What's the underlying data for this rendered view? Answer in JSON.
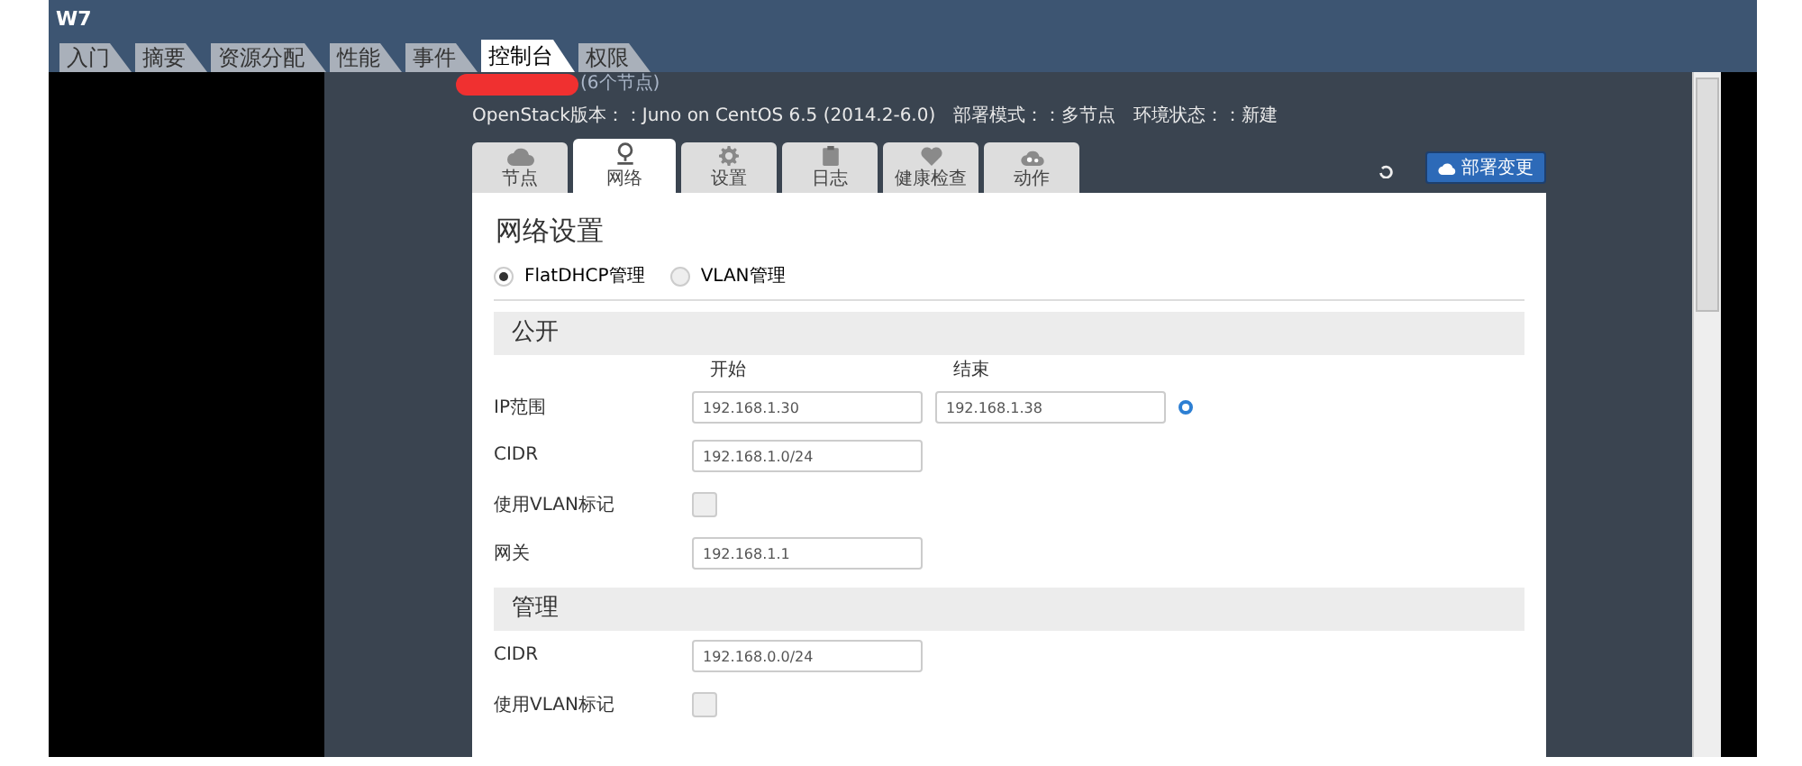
{
  "window": {
    "title": "W7"
  },
  "tabs": [
    {
      "label": "入门",
      "selected": false
    },
    {
      "label": "摘要",
      "selected": false
    },
    {
      "label": "资源分配",
      "selected": false
    },
    {
      "label": "性能",
      "selected": false
    },
    {
      "label": "事件",
      "selected": false
    },
    {
      "label": "控制台",
      "selected": true
    },
    {
      "label": "权限",
      "selected": false
    }
  ],
  "environment": {
    "node_count": "(6个节点)",
    "info": [
      "OpenStack版本：：Juno on CentOS 6.5 (2014.2-6.0)",
      "部署模式：：多节点",
      "环境状态：：新建"
    ]
  },
  "icon_tabs": [
    {
      "label": "节点",
      "kind": "cloud",
      "selected": false
    },
    {
      "label": "网络",
      "kind": "network",
      "selected": true
    },
    {
      "label": "设置",
      "kind": "gear",
      "selected": false
    },
    {
      "label": "日志",
      "kind": "clipboard",
      "selected": false
    },
    {
      "label": "健康检查",
      "kind": "heart",
      "selected": false
    },
    {
      "label": "动作",
      "kind": "cogs",
      "selected": false
    }
  ],
  "deploy_button": "部署变更",
  "form": {
    "title": "网络设置",
    "network_modes": [
      {
        "label": "FlatDHCP管理",
        "selected": true
      },
      {
        "label": "VLAN管理",
        "selected": false
      }
    ],
    "sections": [
      {
        "title": "公开",
        "fields": [
          {
            "kind": "range",
            "label": "IP范围",
            "start_label": "开始",
            "end_label": "结束",
            "start": "192.168.1.30",
            "end": "192.168.1.38"
          },
          {
            "kind": "text",
            "label": "CIDR",
            "value": "192.168.1.0/24"
          },
          {
            "kind": "checkbox",
            "label": "使用VLAN标记",
            "checked": false
          },
          {
            "kind": "text",
            "label": "网关",
            "value": "192.168.1.1"
          }
        ]
      },
      {
        "title": "管理",
        "fields": [
          {
            "kind": "text",
            "label": "CIDR",
            "value": "192.168.0.0/24"
          },
          {
            "kind": "checkbox",
            "label": "使用VLAN标记",
            "checked": false
          }
        ]
      }
    ]
  }
}
